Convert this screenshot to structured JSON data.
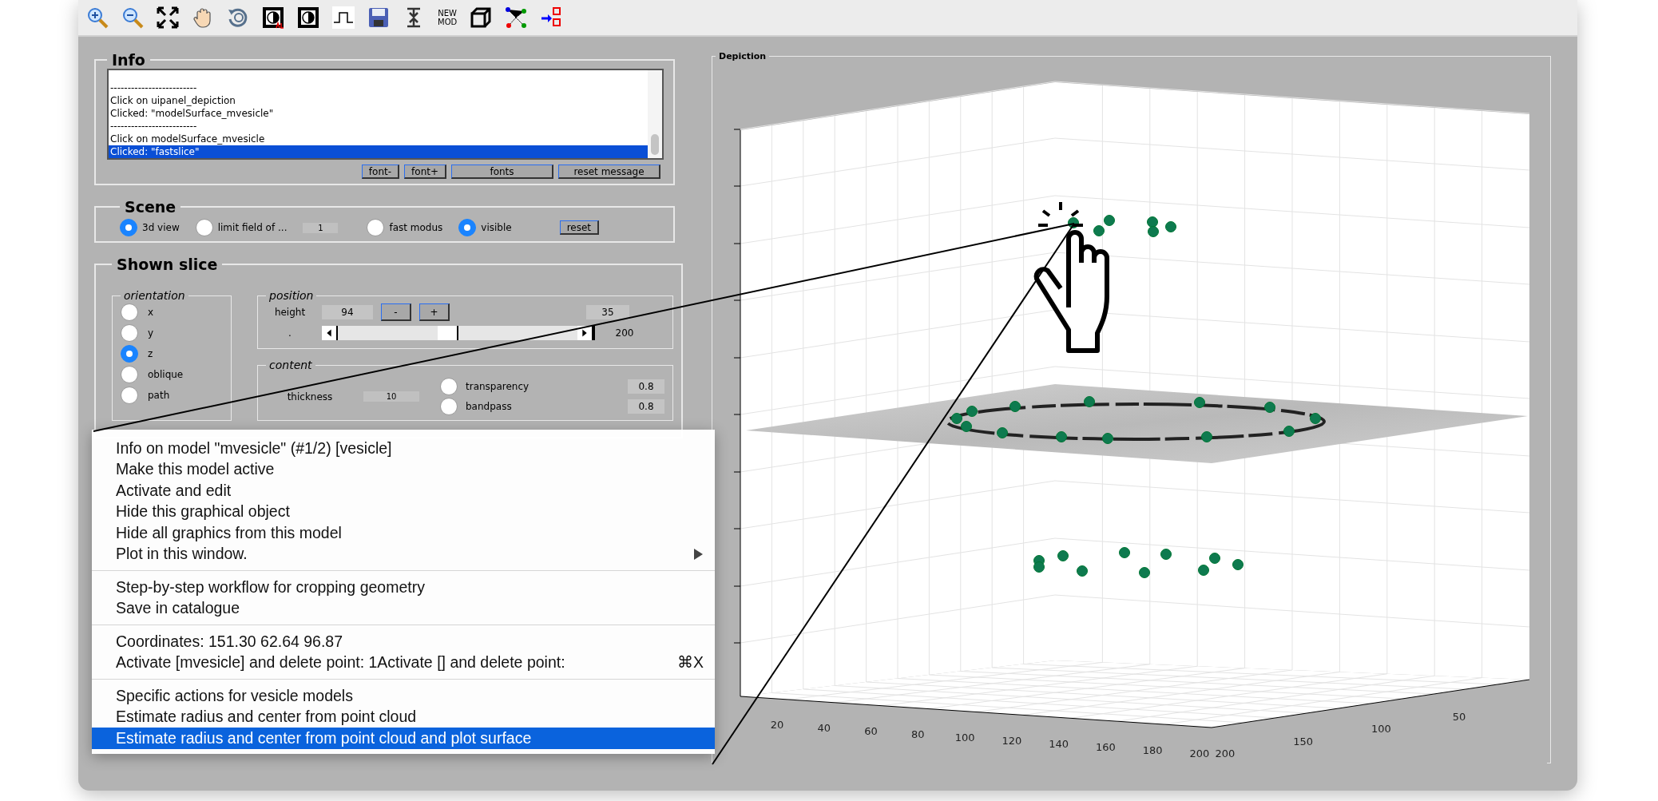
{
  "toolbar": [
    {
      "kind": "zoom-in"
    },
    {
      "kind": "zoom-out"
    },
    {
      "kind": "fit"
    },
    {
      "kind": "pan"
    },
    {
      "kind": "rotate"
    },
    {
      "kind": "contrast-mark"
    },
    {
      "kind": "contrast"
    },
    {
      "kind": "pulse"
    },
    {
      "kind": "save"
    },
    {
      "kind": "collapse"
    },
    {
      "kind": "label",
      "lines": [
        "NEW",
        "MOD"
      ]
    },
    {
      "kind": "cube"
    },
    {
      "kind": "graph"
    },
    {
      "kind": "transfer"
    }
  ],
  "info": {
    "title": "Info",
    "log": [
      {
        "text": "-------------------------",
        "selected": false
      },
      {
        "text": "Click on uipanel_depiction",
        "selected": false
      },
      {
        "text": "Clicked: \"modelSurface_mvesicle\"",
        "selected": false
      },
      {
        "text": "-------------------------",
        "selected": false
      },
      {
        "text": "Click on modelSurface_mvesicle",
        "selected": false
      },
      {
        "text": "Clicked: \"fastslice\"",
        "selected": true
      }
    ],
    "buttons": [
      "font-",
      "font+",
      "fonts",
      "reset message"
    ]
  },
  "scene": {
    "title": "Scene",
    "controls": [
      {
        "kind": "toggle",
        "label": "3d view",
        "checked": true
      },
      {
        "kind": "toggle",
        "label": "limit field of ...",
        "checked": false
      },
      {
        "kind": "field",
        "value": "1"
      },
      {
        "kind": "toggle",
        "label": "fast modus",
        "checked": false
      },
      {
        "kind": "toggle",
        "label": "visible",
        "checked": true
      },
      {
        "kind": "button",
        "label": "reset"
      }
    ]
  },
  "shown_slice": {
    "title": "Shown slice",
    "orientation": {
      "title": "orientation",
      "options": [
        {
          "label": "x",
          "selected": false
        },
        {
          "label": "y",
          "selected": false
        },
        {
          "label": "z",
          "selected": true
        },
        {
          "label": "oblique",
          "selected": false
        },
        {
          "label": "path",
          "selected": false
        }
      ]
    },
    "position": {
      "title": "position",
      "height_label": "height",
      "height_value": "94",
      "minus": "-",
      "plus": "+",
      "step_value": "35",
      "slider_label": ".",
      "level": 0.47,
      "slider_max": "200"
    },
    "content": {
      "title": "content",
      "thickness_label": "thickness",
      "thickness_value": "10",
      "toggles": [
        {
          "label": "transparency",
          "checked": false,
          "value": "0.8"
        },
        {
          "label": "bandpass",
          "checked": false,
          "value": "0.8"
        }
      ]
    }
  },
  "context_menu": {
    "groups": [
      [
        {
          "label": "Info on model \"mvesicle\"  (#1/2) [vesicle]",
          "selected": false,
          "submenu": false
        },
        {
          "label": "Make this model active",
          "selected": false,
          "submenu": false
        },
        {
          "label": "Activate and edit",
          "selected": false,
          "submenu": false
        },
        {
          "label": "Hide this graphical object",
          "selected": false,
          "submenu": false
        },
        {
          "label": "Hide all graphics from this model",
          "selected": false,
          "submenu": false
        },
        {
          "label": "Plot in this window.",
          "selected": false,
          "submenu": true
        }
      ],
      [
        {
          "label": "Step-by-step workflow for cropping geometry",
          "selected": false,
          "submenu": false
        },
        {
          "label": "Save in catalogue",
          "selected": false,
          "submenu": false
        }
      ],
      [
        {
          "label": "Coordinates: 151.30 62.64 96.87",
          "selected": false,
          "submenu": false
        },
        {
          "label": "Activate [mvesicle] and delete point:  1Activate [] and delete point:",
          "shortcut": "⌘X",
          "selected": false,
          "submenu": false
        }
      ],
      [
        {
          "label": "Specific actions for vesicle models",
          "selected": false,
          "submenu": false
        },
        {
          "label": "Estimate radius and center from point cloud",
          "selected": false,
          "submenu": false
        },
        {
          "label": "Estimate radius and center from point cloud and plot surface",
          "selected": true,
          "submenu": false
        }
      ]
    ]
  },
  "depiction": {
    "title": "Depiction",
    "x_ticks": [
      "20",
      "40",
      "60",
      "80",
      "100",
      "120",
      "140",
      "160",
      "180",
      "200"
    ],
    "y_ticks": [
      "200",
      "150",
      "100",
      "50"
    ]
  }
}
